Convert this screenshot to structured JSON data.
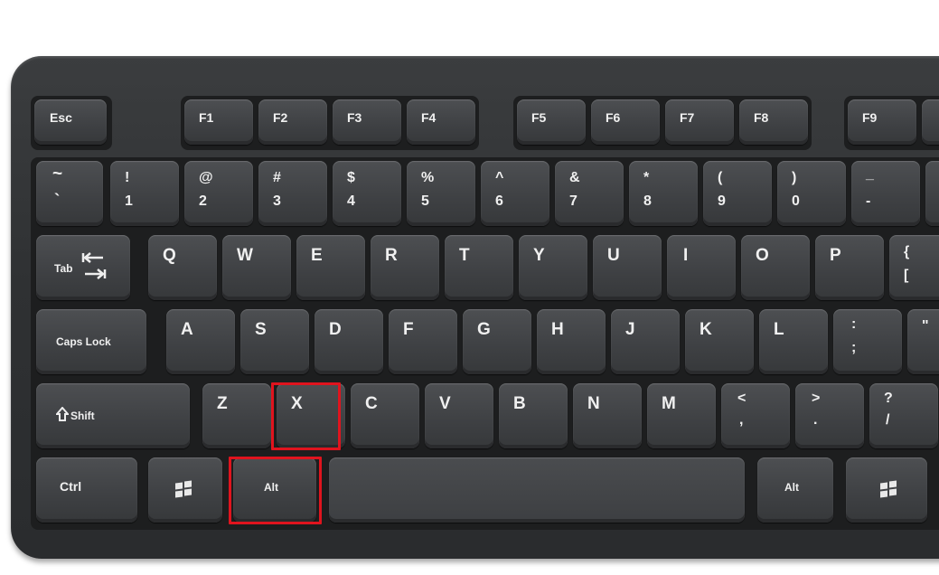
{
  "keyboard": {
    "function_row": [
      "Esc",
      "F1",
      "F2",
      "F3",
      "F4",
      "F5",
      "F6",
      "F7",
      "F8",
      "F9"
    ],
    "number_row": [
      {
        "top": "~",
        "bottom": "`"
      },
      {
        "top": "!",
        "bottom": "1"
      },
      {
        "top": "@",
        "bottom": "2"
      },
      {
        "top": "#",
        "bottom": "3"
      },
      {
        "top": "$",
        "bottom": "4"
      },
      {
        "top": "%",
        "bottom": "5"
      },
      {
        "top": "^",
        "bottom": "6"
      },
      {
        "top": "&",
        "bottom": "7"
      },
      {
        "top": "*",
        "bottom": "8"
      },
      {
        "top": "(",
        "bottom": "9"
      },
      {
        "top": ")",
        "bottom": "0"
      },
      {
        "top": "_",
        "bottom": "-"
      }
    ],
    "qwerty_row": {
      "tab": "Tab",
      "keys": [
        "Q",
        "W",
        "E",
        "R",
        "T",
        "Y",
        "U",
        "I",
        "O",
        "P"
      ],
      "brace_top": "{",
      "brace_bottom": "["
    },
    "home_row": {
      "caps": "Caps Lock",
      "keys": [
        "A",
        "S",
        "D",
        "F",
        "G",
        "H",
        "J",
        "K",
        "L"
      ],
      "semi_top": ":",
      "semi_bottom": ";",
      "quote_top": "\""
    },
    "bottom_letter_row": {
      "shift": "Shift",
      "keys": [
        "Z",
        "X",
        "C",
        "V",
        "B",
        "N",
        "M"
      ],
      "comma_top": "<",
      "comma_bottom": ",",
      "period_top": ">",
      "period_bottom": ".",
      "slash_top": "?",
      "slash_bottom": "/"
    },
    "modifier_row": {
      "ctrl": "Ctrl",
      "alt_left": "Alt",
      "alt_right": "Alt"
    }
  },
  "highlighted_keys": [
    "X",
    "Alt"
  ],
  "colors": {
    "highlight": "#e0141e",
    "keycap": "#3e4043",
    "body": "#2f3133"
  }
}
